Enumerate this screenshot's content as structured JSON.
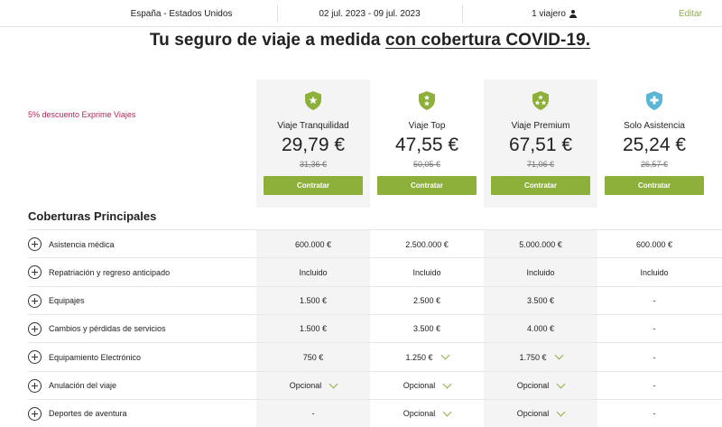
{
  "summary": {
    "route": "España - Estados Unidos",
    "dates": "02 jul. 2023 - 09 jul. 2023",
    "travelers": "1 viajero",
    "travelers_icon": "user-icon",
    "edit_label": "Editar"
  },
  "headline": {
    "text": "Tu seguro de viaje a medida",
    "link": "con cobertura COVID-19."
  },
  "promo": "5% descuento Exprime Viajes",
  "colors": {
    "accent": "#8db03b",
    "blue": "#5bb6d6",
    "promo": "#b5275a"
  },
  "plans": [
    {
      "name": "Viaje Tranquilidad",
      "price": "29,79 €",
      "old_price": "31,36 €",
      "button": "Contratar",
      "icon": "star-shield-icon"
    },
    {
      "name": "Viaje Top",
      "price": "47,55 €",
      "old_price": "50,05 €",
      "button": "Contratar",
      "icon": "star-shield-icon"
    },
    {
      "name": "Viaje Premium",
      "price": "67,51 €",
      "old_price": "71,06 €",
      "button": "Contratar",
      "icon": "three-star-shield-icon"
    },
    {
      "name": "Solo Asistencia",
      "price": "25,24 €",
      "old_price": "26,57 €",
      "button": "Contratar",
      "icon": "cross-shield-icon"
    }
  ],
  "section_title": "Coberturas Principales",
  "coverages": [
    {
      "label": "Asistencia médica",
      "values": [
        "600.000 €",
        "2.500.000 €",
        "5.000.000 €",
        "600.000 €"
      ],
      "dropdown": [
        false,
        false,
        false,
        false
      ]
    },
    {
      "label": "Repatriación y regreso anticipado",
      "values": [
        "Incluido",
        "Incluido",
        "Incluido",
        "Incluido"
      ],
      "dropdown": [
        false,
        false,
        false,
        false
      ]
    },
    {
      "label": "Equipajes",
      "values": [
        "1.500 €",
        "2.500 €",
        "3.500 €",
        "-"
      ],
      "dropdown": [
        false,
        false,
        false,
        false
      ]
    },
    {
      "label": "Cambios y pérdidas de servicios",
      "values": [
        "1.500 €",
        "3.500 €",
        "4.000 €",
        "-"
      ],
      "dropdown": [
        false,
        false,
        false,
        false
      ]
    },
    {
      "label": "Equipamiento Electrónico",
      "values": [
        "750 €",
        "1.250 €",
        "1.750 €",
        "-"
      ],
      "dropdown": [
        false,
        true,
        true,
        false
      ]
    },
    {
      "label": "Anulación del viaje",
      "values": [
        "Opcional",
        "Opcional",
        "Opcional",
        "-"
      ],
      "dropdown": [
        true,
        true,
        true,
        false
      ]
    },
    {
      "label": "Deportes de aventura",
      "values": [
        "-",
        "Opcional",
        "Opcional",
        "-"
      ],
      "dropdown": [
        false,
        true,
        true,
        false
      ]
    }
  ]
}
